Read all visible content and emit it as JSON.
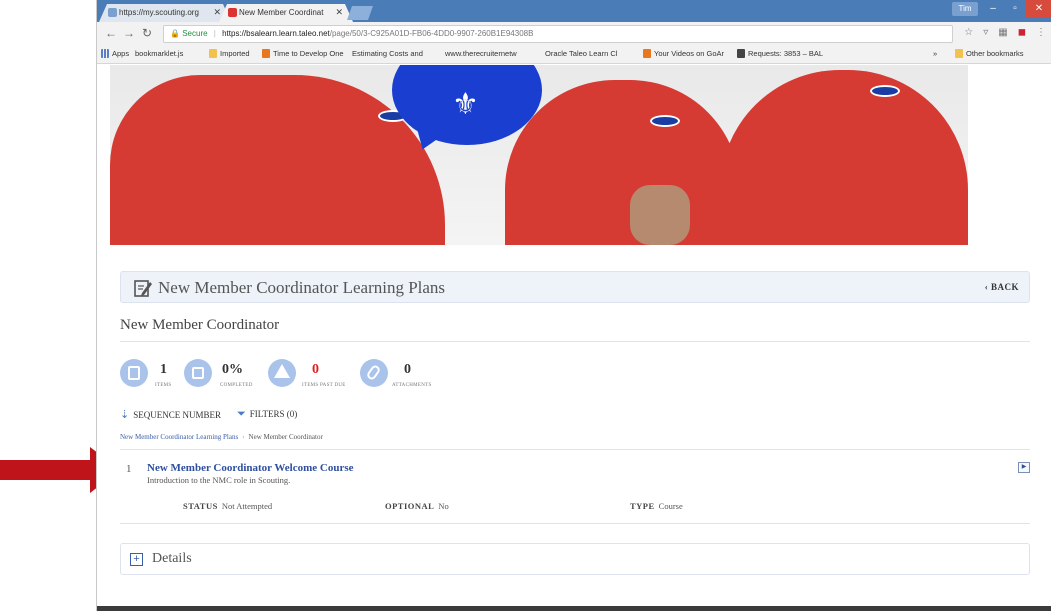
{
  "browser": {
    "tabs": [
      {
        "title": "https://my.scouting.org",
        "active": false
      },
      {
        "title": "New Member Coordinat",
        "active": true
      }
    ],
    "user_badge": "Tim",
    "address": {
      "secure_label": "Secure",
      "host": "https://bsalearn.learn.taleo.net",
      "path": "/page/50/3-C925A01D-FB06-4DD0-9907-260B1E94308B"
    },
    "bookmarks": [
      {
        "label": "Apps",
        "icon": "grid"
      },
      {
        "label": "bookmarklet.js",
        "icon": "page"
      },
      {
        "label": "Imported",
        "icon": "folder"
      },
      {
        "label": "Time to Develop One",
        "icon": "orange"
      },
      {
        "label": "Estimating Costs and",
        "icon": "page"
      },
      {
        "label": "www.therecruiternetw",
        "icon": "page"
      },
      {
        "label": "Oracle Taleo Learn Cl",
        "icon": "page"
      },
      {
        "label": "Your Videos on GoAr",
        "icon": "orange"
      },
      {
        "label": "Requests: 3853 – BAL",
        "icon": "dark"
      }
    ],
    "bookmarks_overflow": "»",
    "other_bookmarks": "Other bookmarks"
  },
  "plan": {
    "header_title": "New Member Coordinator Learning Plans",
    "back_label": "BACK",
    "subtitle": "New Member Coordinator",
    "stats": [
      {
        "value": "1",
        "label": "ITEMS"
      },
      {
        "value": "0%",
        "label": "COMPLETED"
      },
      {
        "value": "0",
        "label": "ITEMS PAST DUE"
      },
      {
        "value": "0",
        "label": "ATTACHMENTS"
      }
    ],
    "sort_label": "SEQUENCE NUMBER",
    "filters_label": "FILTERS (0)",
    "breadcrumb": {
      "root": "New Member Coordinator Learning Plans",
      "separator": "›",
      "current": "New Member Coordinator"
    },
    "course": {
      "number": "1",
      "title": "New Member Coordinator Welcome Course",
      "description": "Introduction to the NMC role in Scouting.",
      "status_label": "STATUS",
      "status_value": "Not Attempted",
      "optional_label": "OPTIONAL",
      "optional_value": "No",
      "type_label": "TYPE",
      "type_value": "Course"
    },
    "details_label": "Details"
  },
  "colors": {
    "accent": "#2d4f9e",
    "arrow": "#c0141b",
    "shirt": "#d63b33",
    "tab_strip": "#4a7cb8"
  }
}
